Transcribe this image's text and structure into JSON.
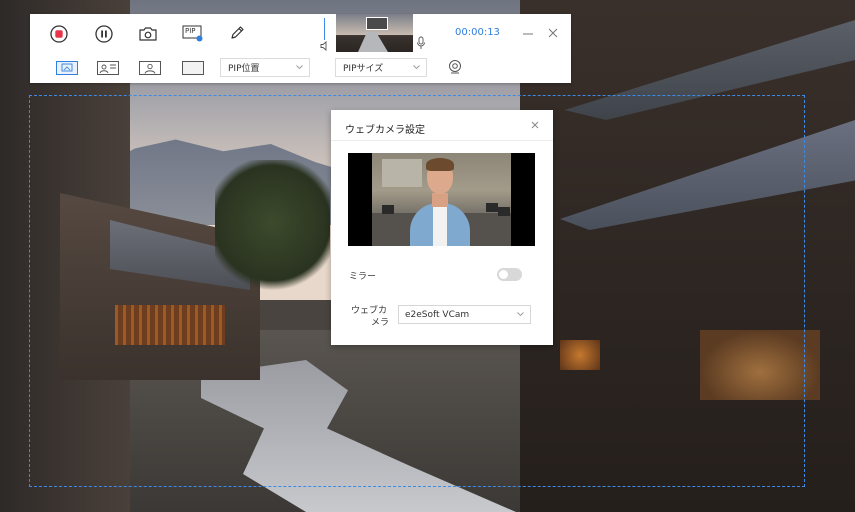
{
  "toolbar": {
    "buttons": {
      "record": "record-icon",
      "pause": "pause-icon",
      "screenshot": "camera-icon",
      "pip": "PIP",
      "annotate": "pencil-icon"
    },
    "timer": "00:00:13",
    "row2": {
      "pip_position_label": "PIP位置",
      "pip_size_label": "PIPサイズ"
    },
    "colors": {
      "accent": "#2f7fe0",
      "record": "#e8354a"
    }
  },
  "dialog": {
    "title": "ウェブカメラ設定",
    "mirror_label": "ミラー",
    "mirror_on": false,
    "webcam_label_line1": "ウェブカ",
    "webcam_label_line2": "メラ",
    "webcam_device": "e2eSoft VCam"
  }
}
